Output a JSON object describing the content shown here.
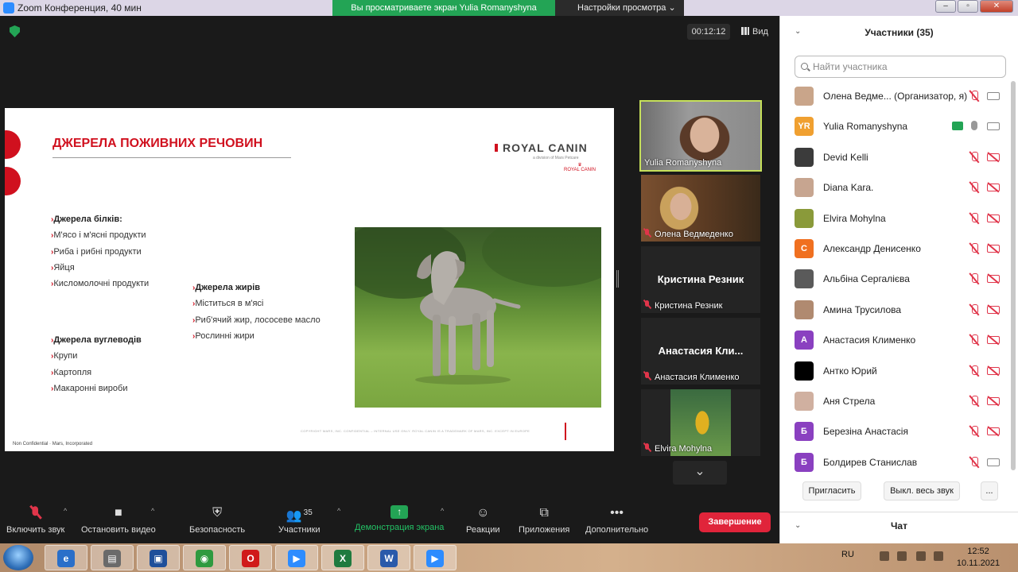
{
  "window": {
    "title": "Zoom Конференция, 40 мин",
    "share_banner": "Вы просматриваете экран Yulia Romanyshyna",
    "view_settings": "Настройки просмотра",
    "caret": "⌄"
  },
  "meeting": {
    "timer": "00:12:12",
    "view_label": "Вид"
  },
  "slide": {
    "title": "ДЖЕРЕЛА ПОЖИВНИХ РЕЧОВИН",
    "logo": "ROYAL CANIN",
    "logo_sub": "a division of Mars Petcare",
    "logo_crown": "ROYAL CANIN",
    "proteins": {
      "heading": "Джерела білків:",
      "items": [
        "М'ясо і м'ясні продукти",
        "Риба і рибні продукти",
        "Яйця",
        "Кисломолочні продукти"
      ]
    },
    "fats": {
      "heading": "Джерела жирів",
      "items": [
        "Міститься в м'ясі",
        "Риб'ячий жир, лососеве масло",
        "Рослинні жири"
      ]
    },
    "carbs": {
      "heading": "Джерела вуглеводів",
      "items": [
        "Крупи",
        "Картопля",
        "Макаронні вироби"
      ]
    },
    "copyright": "COPYRIGHT MARS, INC. CONFIDENTIAL – INTERNAL USE ONLY. ROYAL CANIN IS A TRADEMARK OF MARS, INC. EXCEPT IN EUROPE",
    "footer": "Non Confidential · Mars, Incorporated"
  },
  "videos": [
    {
      "name": "Yulia Romanyshyna",
      "muted": false
    },
    {
      "name": "Олена Ведмеденко",
      "muted": true
    },
    {
      "name": "Кристина Резник",
      "muted": true,
      "big": "Кристина Резник"
    },
    {
      "name": "Анастасия Клименко",
      "muted": true,
      "big": "Анастасия  Кли..."
    },
    {
      "name": "Elvira Mohylna",
      "muted": true
    }
  ],
  "toolbar": {
    "mute": "Включить звук",
    "video": "Остановить видео",
    "security": "Безопасность",
    "participants": "Участники",
    "participants_count": "35",
    "share": "Демонстрация экрана",
    "reactions": "Реакции",
    "apps": "Приложения",
    "more": "Дополнительно",
    "end": "Завершение",
    "caret": "^",
    "next": "⌄"
  },
  "panel": {
    "title": "Участники (35)",
    "collapse": "⌄",
    "search_placeholder": "Найти участника",
    "participants": [
      {
        "name": "Олена Ведме...  (Организатор, я)",
        "avatar": "",
        "color": "#c9a58a",
        "mic": "off",
        "video": "on"
      },
      {
        "name": "Yulia Romanyshyna",
        "avatar": "YR",
        "color": "#f0a030",
        "mic": "on",
        "video": "on",
        "sharing": true
      },
      {
        "name": "Devid Kelli",
        "avatar": "",
        "color": "#3b3b3b",
        "mic": "off",
        "video": "off"
      },
      {
        "name": "Diana Kara.",
        "avatar": "",
        "color": "#c7a590",
        "mic": "off",
        "video": "off"
      },
      {
        "name": "Elvira Mohylna",
        "avatar": "",
        "color": "#8a9a3a",
        "mic": "off",
        "video": "off"
      },
      {
        "name": "Александр Денисенко",
        "avatar": "С",
        "color": "#f07020",
        "mic": "off",
        "video": "off"
      },
      {
        "name": "Альбіна Сергалієва",
        "avatar": "",
        "color": "#5a5a5a",
        "mic": "off",
        "video": "off"
      },
      {
        "name": "Амина Трусилова",
        "avatar": "",
        "color": "#b08a70",
        "mic": "off",
        "video": "off"
      },
      {
        "name": "Анастасия Клименко",
        "avatar": "А",
        "color": "#8a40c0",
        "mic": "off",
        "video": "off"
      },
      {
        "name": "Антко Юрий",
        "avatar": "",
        "color": "#000000",
        "mic": "off",
        "video": "off"
      },
      {
        "name": "Аня Стрела",
        "avatar": "",
        "color": "#d0b0a0",
        "mic": "off",
        "video": "off"
      },
      {
        "name": "Березіна Анастасія",
        "avatar": "Б",
        "color": "#8a40c0",
        "mic": "off",
        "video": "off"
      },
      {
        "name": "Болдирев Станислав",
        "avatar": "Б",
        "color": "#8a40c0",
        "mic": "off",
        "video": "on"
      }
    ],
    "invite": "Пригласить",
    "mute_all": "Выкл. весь звук",
    "more": "...",
    "chat": "Чат"
  },
  "taskbar": {
    "lang": "RU",
    "time": "12:52",
    "date": "10.11.2021",
    "apps": [
      {
        "glyph": "e",
        "color": "#2a6fc9"
      },
      {
        "glyph": "▤",
        "color": "#6a6a6a"
      },
      {
        "glyph": "▣",
        "color": "#1e4f9a"
      },
      {
        "glyph": "◉",
        "color": "#2f9a3f"
      },
      {
        "glyph": "O",
        "color": "#d01a1a"
      },
      {
        "glyph": "▶",
        "color": "#2d8cff"
      },
      {
        "glyph": "X",
        "color": "#1f7a3f"
      },
      {
        "glyph": "W",
        "color": "#2a5aaa"
      },
      {
        "glyph": "▶",
        "color": "#2d8cff"
      }
    ]
  }
}
